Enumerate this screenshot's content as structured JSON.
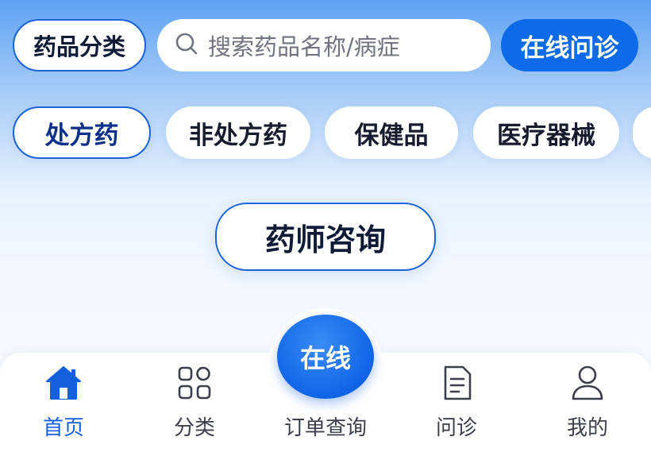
{
  "header": {
    "category_label": "药品分类",
    "search_placeholder": "搜索药品名称/病症",
    "consult_label": "在线问诊"
  },
  "tabs": [
    {
      "label": "处方药"
    },
    {
      "label": "非处方药"
    },
    {
      "label": "保健品"
    },
    {
      "label": "医疗器械"
    }
  ],
  "main": {
    "pharmacist_label": "药师咨询"
  },
  "bottom_nav": {
    "fab_label": "在线",
    "items": [
      {
        "label": "首页",
        "icon": "home-icon"
      },
      {
        "label": "分类",
        "icon": "grid-icon"
      },
      {
        "label": "订单查询",
        "icon": ""
      },
      {
        "label": "问诊",
        "icon": "document-icon"
      },
      {
        "label": "我的",
        "icon": "user-icon"
      }
    ]
  },
  "colors": {
    "accent": "#0d6bea",
    "active_text": "#1460dc"
  }
}
